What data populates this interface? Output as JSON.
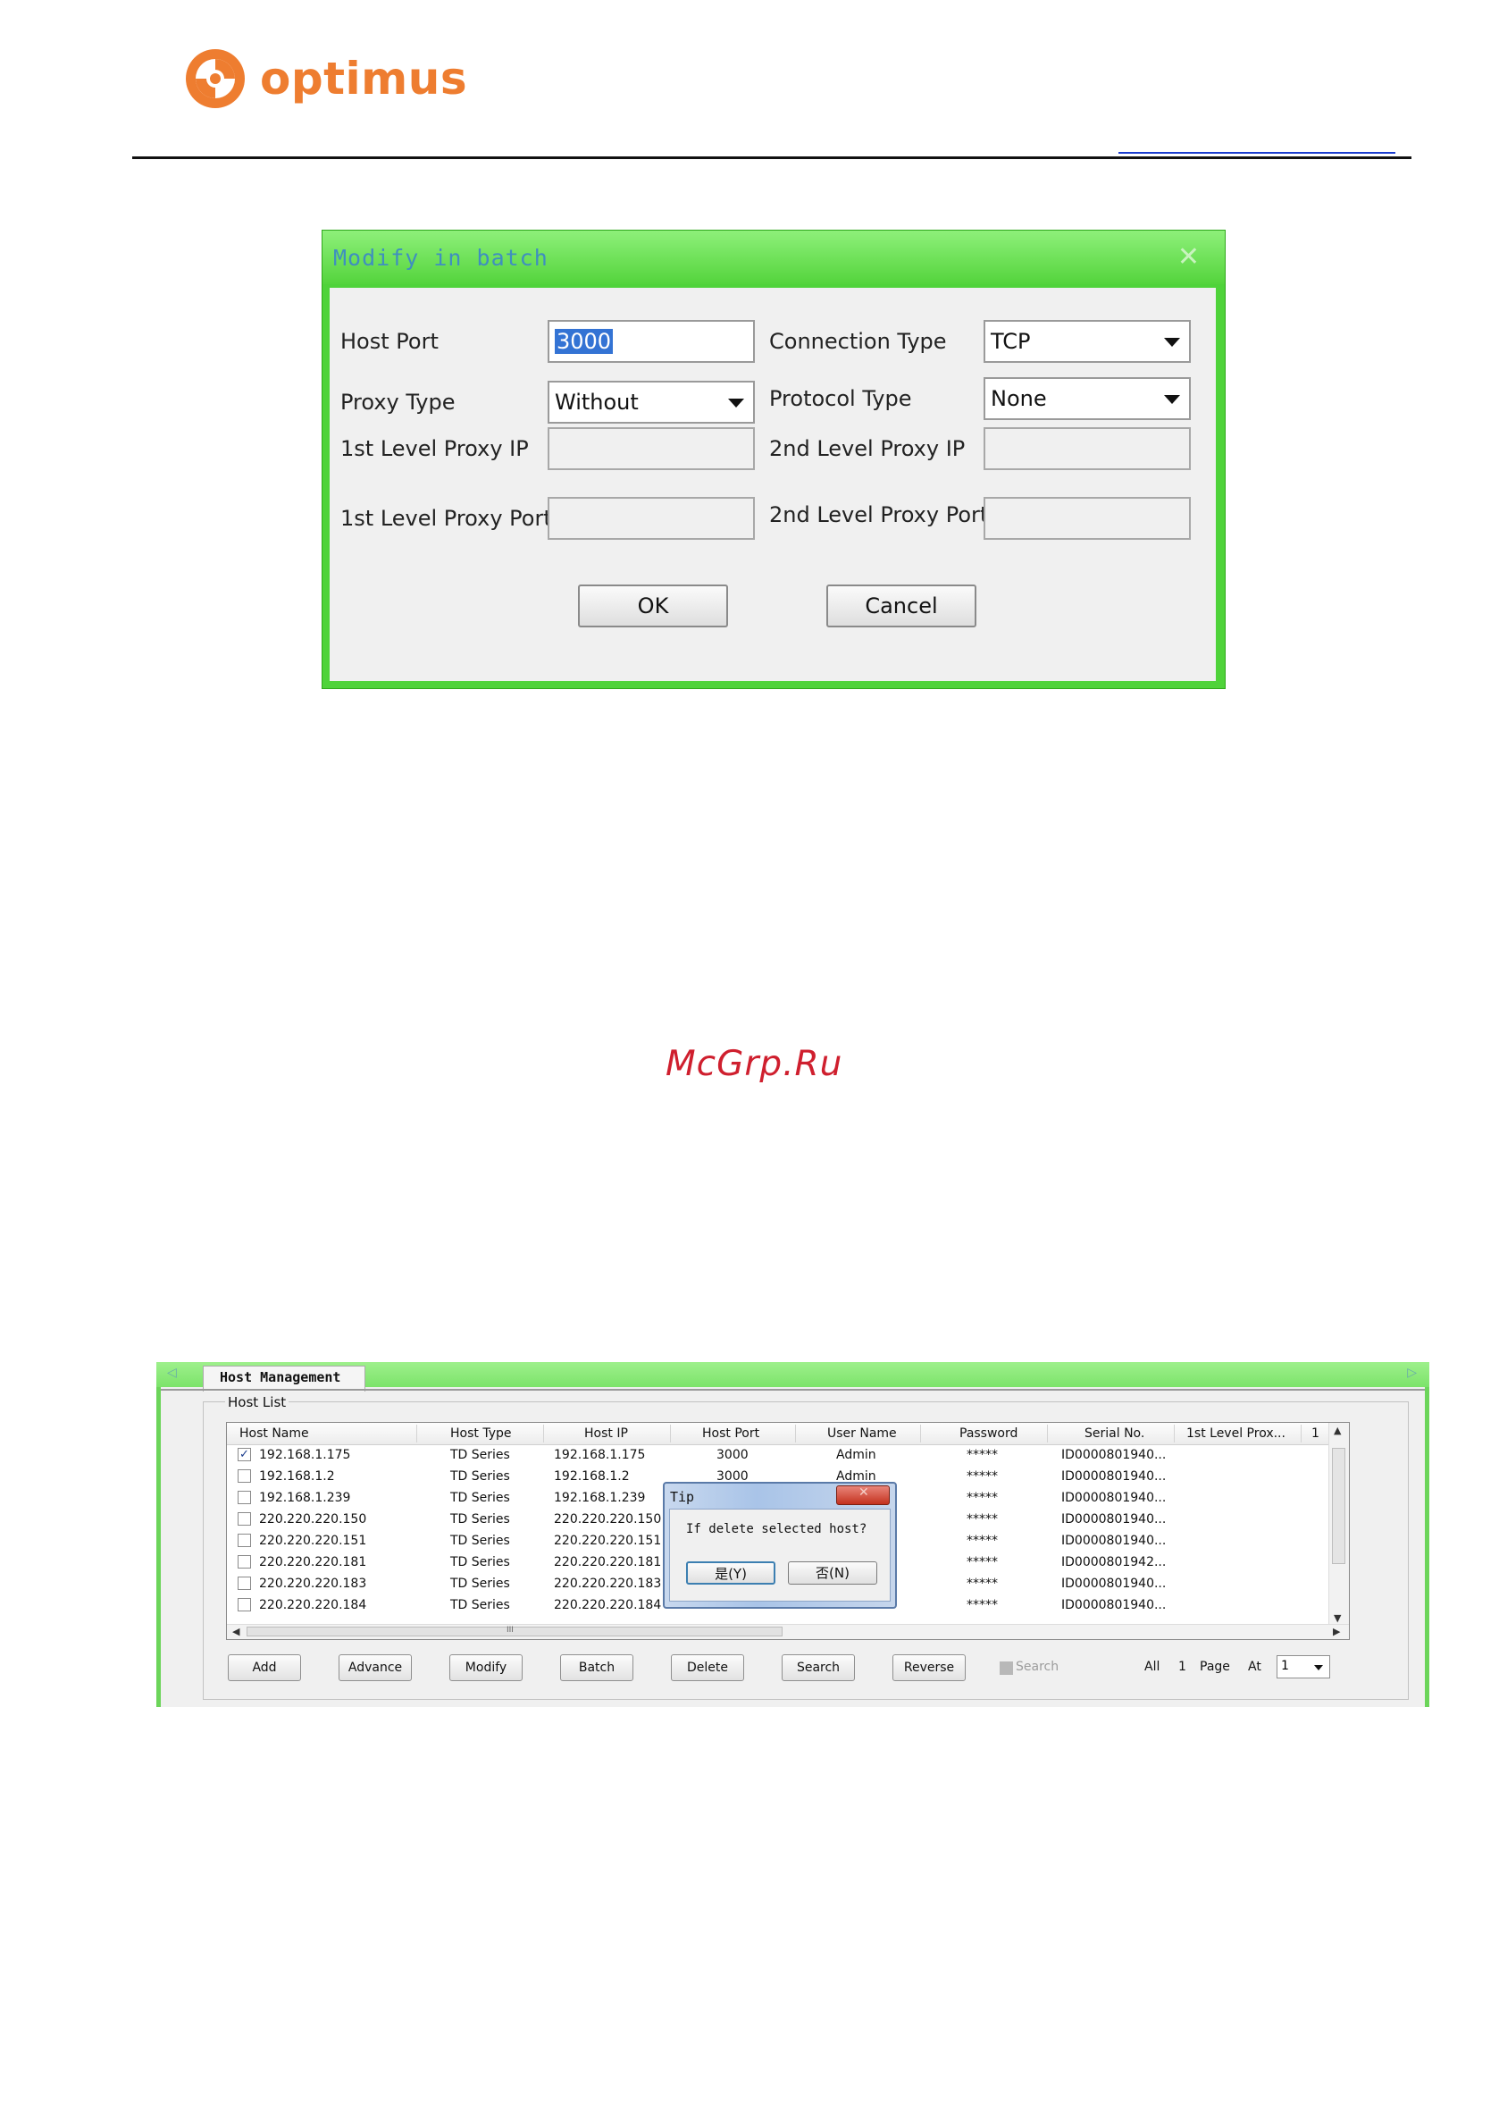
{
  "header": {
    "logo_text": "optimus",
    "brand_color": "#ee7d30"
  },
  "batch_dialog": {
    "title": "Modify in batch",
    "close_icon": "close-icon",
    "fields": {
      "host_port_label": "Host Port",
      "host_port_value": "3000",
      "connection_type_label": "Connection Type",
      "connection_type_value": "TCP",
      "proxy_type_label": "Proxy Type",
      "proxy_type_value": "Without",
      "protocol_type_label": "Protocol Type",
      "protocol_type_value": "None",
      "proxy1_ip_label": "1st Level Proxy IP",
      "proxy2_ip_label": "2nd Level Proxy IP",
      "proxy1_port_label": "1st Level Proxy Port",
      "proxy2_port_label": "2nd Level Proxy Port"
    },
    "ok_label": "OK",
    "cancel_label": "Cancel",
    "accent_color": "#4fd33a"
  },
  "watermark": "McGrp.Ru",
  "host_management": {
    "tab_label": "Host Management",
    "group_label": "Host List",
    "columns": [
      "Host Name",
      "Host Type",
      "Host IP",
      "Host Port",
      "User Name",
      "Password",
      "Serial No.",
      "1st Level Prox...",
      "1"
    ],
    "rows": [
      {
        "checked": true,
        "name": "192.168.1.175",
        "type": "TD Series",
        "ip": "192.168.1.175",
        "port": "3000",
        "user": "Admin",
        "password": "*****",
        "serial": "ID0000801940..."
      },
      {
        "checked": false,
        "name": "192.168.1.2",
        "type": "TD Series",
        "ip": "192.168.1.2",
        "port": "3000",
        "user": "Admin",
        "password": "*****",
        "serial": "ID0000801940..."
      },
      {
        "checked": false,
        "name": "192.168.1.239",
        "type": "TD Series",
        "ip": "192.168.1.239",
        "port": "",
        "user": "",
        "password": "*****",
        "serial": "ID0000801940..."
      },
      {
        "checked": false,
        "name": "220.220.220.150",
        "type": "TD Series",
        "ip": "220.220.220.150",
        "port": "",
        "user": "",
        "password": "*****",
        "serial": "ID0000801940..."
      },
      {
        "checked": false,
        "name": "220.220.220.151",
        "type": "TD Series",
        "ip": "220.220.220.151",
        "port": "",
        "user": "",
        "password": "*****",
        "serial": "ID0000801940..."
      },
      {
        "checked": false,
        "name": "220.220.220.181",
        "type": "TD Series",
        "ip": "220.220.220.181",
        "port": "",
        "user": "",
        "password": "*****",
        "serial": "ID0000801942..."
      },
      {
        "checked": false,
        "name": "220.220.220.183",
        "type": "TD Series",
        "ip": "220.220.220.183",
        "port": "",
        "user": "",
        "password": "*****",
        "serial": "ID0000801940..."
      },
      {
        "checked": false,
        "name": "220.220.220.184",
        "type": "TD Series",
        "ip": "220.220.220.184",
        "port": "",
        "user": "",
        "password": "*****",
        "serial": "ID0000801940..."
      }
    ],
    "buttons": [
      "Add",
      "Advance",
      "Modify",
      "Batch",
      "Delete",
      "Search",
      "Reverse"
    ],
    "search_checkbox_label": "Search",
    "footer": {
      "all_label": "All",
      "total_pages": "1",
      "page_label": "Page",
      "at_label": "At",
      "current_page": "1"
    },
    "hscroll_grip": "III"
  },
  "tip_dialog": {
    "title": "Tip",
    "message": "If delete selected host?",
    "yes_label": "是(Y)",
    "no_label": "否(N)"
  }
}
